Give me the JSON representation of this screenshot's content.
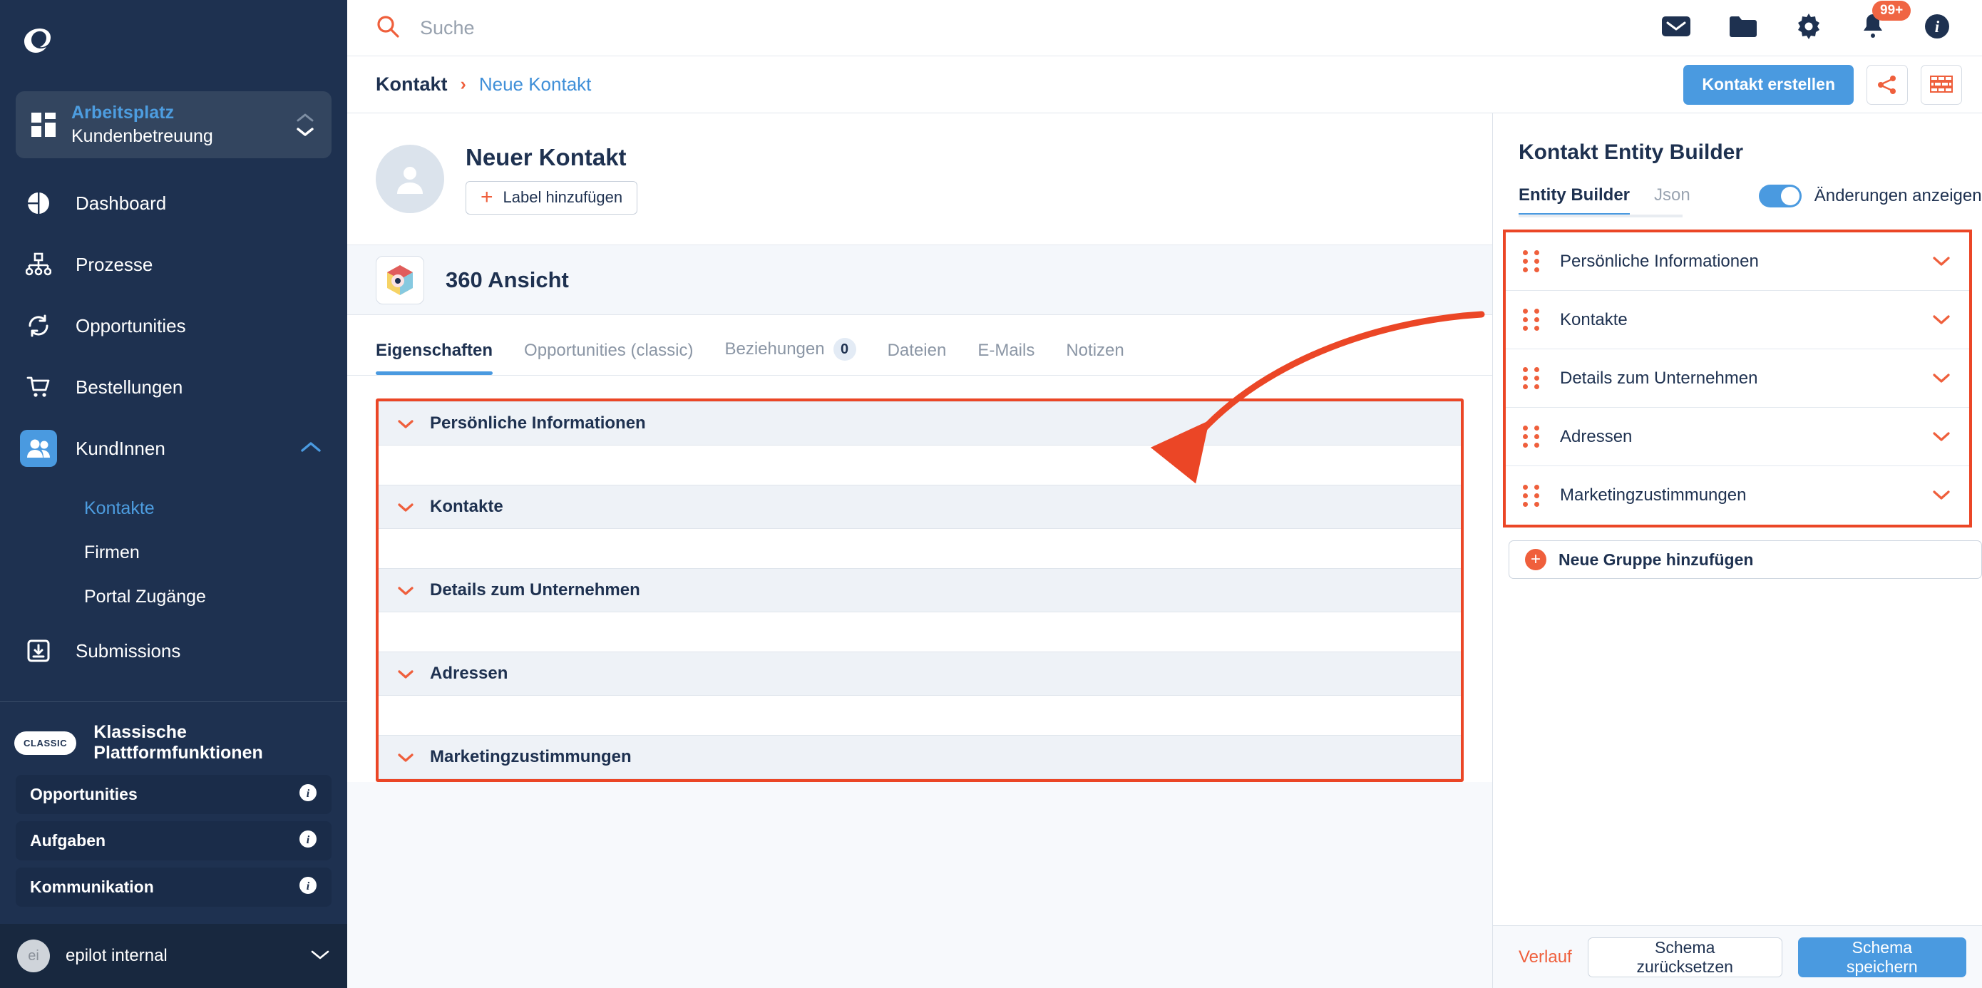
{
  "sidebar": {
    "logo_icon": "epilot-logo-icon",
    "workspace": {
      "label": "Arbeitsplatz",
      "value": "Kundenbetreuung",
      "icon": "grid-icon"
    },
    "nav": [
      {
        "label": "Dashboard",
        "icon": "pie-chart-icon",
        "active": false
      },
      {
        "label": "Prozesse",
        "icon": "hierarchy-icon",
        "active": false
      },
      {
        "label": "Opportunities",
        "icon": "refresh-icon",
        "active": false
      },
      {
        "label": "Bestellungen",
        "icon": "cart-icon",
        "active": false
      },
      {
        "label": "KundInnen",
        "icon": "users-icon",
        "active": true
      }
    ],
    "subnav": [
      {
        "label": "Kontakte",
        "active": true
      },
      {
        "label": "Firmen",
        "active": false
      },
      {
        "label": "Portal Zugänge",
        "active": false
      }
    ],
    "submissions": {
      "label": "Submissions",
      "icon": "inbox-download-icon"
    },
    "classic": {
      "badge": "CLASSIC",
      "title": "Klassische Plattformfunktionen",
      "rows": [
        {
          "label": "Opportunities",
          "icon": "info-icon"
        },
        {
          "label": "Aufgaben",
          "icon": "info-icon"
        },
        {
          "label": "Kommunikation",
          "icon": "info-icon"
        }
      ]
    },
    "user": {
      "initials": "ei",
      "name": "epilot internal",
      "icon": "chevron-down-icon"
    }
  },
  "topbar": {
    "search": {
      "placeholder": "Suche",
      "value": "",
      "icon": "search-icon"
    },
    "icons": [
      {
        "name": "mail-icon"
      },
      {
        "name": "folder-icon"
      },
      {
        "name": "gear-icon"
      },
      {
        "name": "bell-icon",
        "badge": "99+"
      },
      {
        "name": "info-icon"
      }
    ]
  },
  "breadcrumb": {
    "root": "Kontakt",
    "separator": "›",
    "current": "Neue Kontakt",
    "primary_button": "Kontakt erstellen",
    "share_icon": "share-icon",
    "blocks_icon": "bricks-icon"
  },
  "contact": {
    "avatar_icon": "person-avatar-icon",
    "name": "Neuer Kontakt",
    "label_button": "Label hinzufügen",
    "label_plus": "+"
  },
  "view": {
    "icon": "360-view-icon",
    "title": "360 Ansicht"
  },
  "tabs": [
    {
      "label": "Eigenschaften",
      "active": true
    },
    {
      "label": "Opportunities (classic)",
      "active": false
    },
    {
      "label": "Beziehungen",
      "active": false,
      "count": "0"
    },
    {
      "label": "Dateien",
      "active": false
    },
    {
      "label": "E-Mails",
      "active": false
    },
    {
      "label": "Notizen",
      "active": false
    }
  ],
  "accordion_groups": [
    {
      "title": "Persönliche Informationen",
      "chevron": "chevron-down-icon"
    },
    {
      "title": "Kontakte",
      "chevron": "chevron-down-icon"
    },
    {
      "title": "Details zum Unternehmen",
      "chevron": "chevron-down-icon"
    },
    {
      "title": "Adressen",
      "chevron": "chevron-down-icon"
    },
    {
      "title": "Marketingzustimmungen",
      "chevron": "chevron-down-icon"
    }
  ],
  "right_panel": {
    "title": "Kontakt Entity Builder",
    "tabs": [
      {
        "label": "Entity Builder",
        "active": true
      },
      {
        "label": "Json",
        "active": false
      }
    ],
    "toggle": {
      "label": "Änderungen anzeigen",
      "on": true
    },
    "groups": [
      {
        "label": "Persönliche Informationen",
        "drag": "drag-handle-icon",
        "chevron": "chevron-down-icon"
      },
      {
        "label": "Kontakte",
        "drag": "drag-handle-icon",
        "chevron": "chevron-down-icon"
      },
      {
        "label": "Details zum Unternehmen",
        "drag": "drag-handle-icon",
        "chevron": "chevron-down-icon"
      },
      {
        "label": "Adressen",
        "drag": "drag-handle-icon",
        "chevron": "chevron-down-icon"
      },
      {
        "label": "Marketingzustimmungen",
        "drag": "drag-handle-icon",
        "chevron": "chevron-down-icon"
      }
    ],
    "add_group_button": "Neue Gruppe hinzufügen",
    "add_group_plus": "+",
    "footer": {
      "history_link": "Verlauf",
      "reset_button": "Schema zurücksetzen",
      "save_button": "Schema speichern"
    }
  },
  "annotation": {
    "arrow_color": "#eb4626",
    "highlight_color": "#eb4626"
  }
}
